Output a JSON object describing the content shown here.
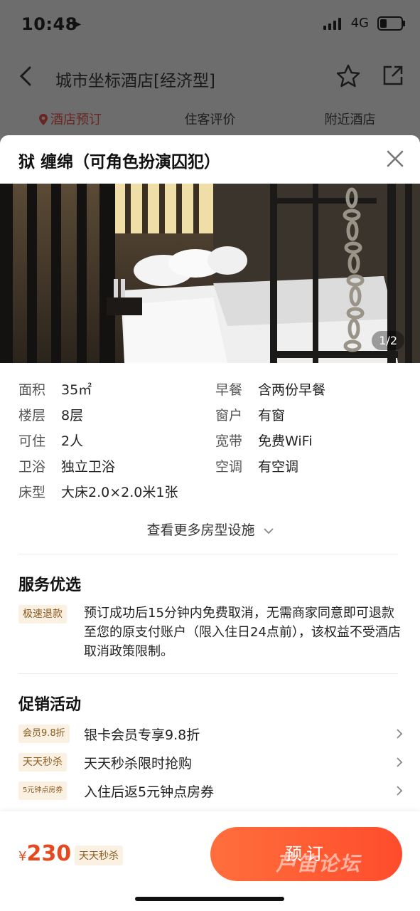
{
  "status": {
    "time": "10:48",
    "network": "4G"
  },
  "nav": {
    "title": "城市坐标酒店[经济型]"
  },
  "tabs": [
    {
      "label": "酒店预订",
      "active": true
    },
    {
      "label": "住客评价",
      "active": false
    },
    {
      "label": "附近酒店",
      "active": false
    }
  ],
  "room": {
    "title": "狱 缠绵（可角色扮演囚犯）",
    "photo_counter": "1/2"
  },
  "facilities": {
    "area_label": "面积",
    "area_value": "35㎡",
    "breakfast_label": "早餐",
    "breakfast_value": "含两份早餐",
    "floor_label": "楼层",
    "floor_value": "8层",
    "window_label": "窗户",
    "window_value": "有窗",
    "occupancy_label": "可住",
    "occupancy_value": "2人",
    "broadband_label": "宽带",
    "broadband_value": "免费WiFi",
    "bathroom_label": "卫浴",
    "bathroom_value": "独立卫浴",
    "ac_label": "空调",
    "ac_value": "有空调",
    "bed_label": "床型",
    "bed_value": "大床2.0×2.0米1张",
    "more_link": "查看更多房型设施"
  },
  "service": {
    "title": "服务优选",
    "badge": "极速退款",
    "text": "预订成功后15分钟内免费取消，无需商家同意即可退款至您的原支付账户（限入住日24点前），该权益不受酒店取消政策限制。"
  },
  "promotions": {
    "title": "促销活动",
    "items": [
      {
        "badge": "会员9.8折",
        "text": "银卡会员专享9.8折"
      },
      {
        "badge": "天天秒杀",
        "text": "天天秒杀限时抢购"
      },
      {
        "badge": "5元钟点房券",
        "text": "入住后返5元钟点房券"
      }
    ]
  },
  "footer": {
    "currency": "¥",
    "price": "230",
    "price_tag": "天天秒杀",
    "book_label": "预订",
    "watermark": "芦笛论坛"
  },
  "colors": {
    "accent": "#ff5a2e",
    "price": "#e6481f",
    "badge_bg": "#fbf1e2"
  }
}
